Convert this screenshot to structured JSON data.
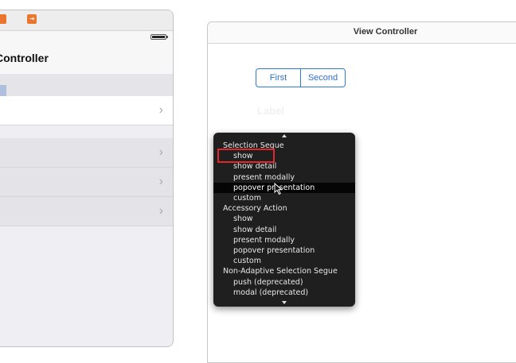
{
  "table_view_controller": {
    "nav_title": "Controller"
  },
  "view_controller": {
    "title": "View Controller",
    "segments": [
      "First",
      "Second"
    ],
    "ghost_label": "Label"
  },
  "segue_menu": {
    "rows": [
      {
        "label": "Selection Segue",
        "kind": "header"
      },
      {
        "label": "show",
        "kind": "item"
      },
      {
        "label": "show detail",
        "kind": "item"
      },
      {
        "label": "present modally",
        "kind": "item"
      },
      {
        "label": "popover presentation",
        "kind": "item",
        "highlighted": true
      },
      {
        "label": "custom",
        "kind": "item"
      },
      {
        "label": "Accessory Action",
        "kind": "header"
      },
      {
        "label": "show",
        "kind": "item"
      },
      {
        "label": "show detail",
        "kind": "item"
      },
      {
        "label": "present modally",
        "kind": "item"
      },
      {
        "label": "popover presentation",
        "kind": "item"
      },
      {
        "label": "custom",
        "kind": "item"
      },
      {
        "label": "Non-Adaptive Selection Segue",
        "kind": "header"
      },
      {
        "label": "push (deprecated)",
        "kind": "item"
      },
      {
        "label": "modal (deprecated)",
        "kind": "item"
      }
    ]
  },
  "colors": {
    "accent": "#3478d6",
    "highlight_box": "#e0282e",
    "menu_bg": "#1f1f1f",
    "icon_orange": "#e9752f"
  }
}
